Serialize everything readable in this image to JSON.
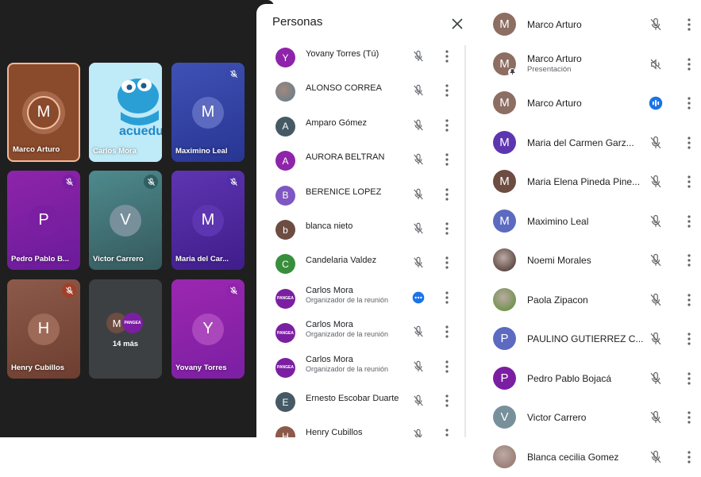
{
  "video_grid": {
    "tiles": [
      {
        "name": "Marco Arturo",
        "initial": "M",
        "muted": false
      },
      {
        "name": "Carlos Mora",
        "initial": "",
        "muted": false,
        "logo_text": "acuedu"
      },
      {
        "name": "Maximino Leal",
        "initial": "M",
        "muted": true
      },
      {
        "name": "Pedro Pablo B...",
        "initial": "P",
        "muted": true
      },
      {
        "name": "Victor Carrero",
        "initial": "V",
        "muted": true
      },
      {
        "name": "Maria del Car...",
        "initial": "M",
        "muted": true
      },
      {
        "name": "Henry Cubillos",
        "initial": "H",
        "muted": true
      },
      {
        "name": "14 más",
        "initial": "M",
        "muted": false,
        "badge_text": "PANGEA"
      },
      {
        "name": "Yovany Torres",
        "initial": "Y",
        "muted": true
      }
    ]
  },
  "panel": {
    "title": "Personas",
    "close_icon": "close-icon",
    "participants": [
      {
        "initial": "Y",
        "name": "Yovany Torres (Tú)",
        "subtitle": "",
        "color": "#8e24aa",
        "mic": "muted"
      },
      {
        "initial": "",
        "name": "ALONSO CORREA",
        "subtitle": "",
        "color": "#607d8b",
        "mic": "muted",
        "photo": true
      },
      {
        "initial": "A",
        "name": "Amparo Gómez",
        "subtitle": "",
        "color": "#455a64",
        "mic": "muted"
      },
      {
        "initial": "A",
        "name": "AURORA BELTRAN",
        "subtitle": "",
        "color": "#8e24aa",
        "mic": "muted"
      },
      {
        "initial": "B",
        "name": "BERENICE LOPEZ",
        "subtitle": "",
        "color": "#7e57c2",
        "mic": "muted"
      },
      {
        "initial": "b",
        "name": "blanca nieto",
        "subtitle": "",
        "color": "#6d4c41",
        "mic": "muted"
      },
      {
        "initial": "C",
        "name": "Candelaria Valdez",
        "subtitle": "",
        "color": "#388e3c",
        "mic": "muted"
      },
      {
        "initial": "PANGEA",
        "name": "Carlos Mora",
        "subtitle": "Organizador de la reunión",
        "color": "#7b1fa2",
        "mic": "active"
      },
      {
        "initial": "PANGEA",
        "name": "Carlos Mora",
        "subtitle": "Organizador de la reunión",
        "color": "#7b1fa2",
        "mic": "muted"
      },
      {
        "initial": "PANGEA",
        "name": "Carlos Mora",
        "subtitle": "Organizador de la reunión",
        "color": "#7b1fa2",
        "mic": "muted"
      },
      {
        "initial": "E",
        "name": "Ernesto Escobar Duarte",
        "subtitle": "",
        "color": "#455a64",
        "mic": "muted"
      },
      {
        "initial": "H",
        "name": "Henry Cubillos",
        "subtitle": "",
        "color": "#8d5a4a",
        "mic": "muted"
      }
    ]
  },
  "right_list": {
    "participants": [
      {
        "initial": "M",
        "name": "Marco Arturo",
        "subtitle": "",
        "color": "#8d6e63",
        "mic": "muted"
      },
      {
        "initial": "M",
        "name": "Marco Arturo",
        "subtitle": "Presentación",
        "color": "#8d6e63",
        "mic": "presenting"
      },
      {
        "initial": "M",
        "name": "Marco Arturo",
        "subtitle": "",
        "color": "#8d6e63",
        "mic": "speaking"
      },
      {
        "initial": "M",
        "name": "Maria del Carmen Garz...",
        "subtitle": "",
        "color": "#5e35b1",
        "mic": "muted"
      },
      {
        "initial": "M",
        "name": "Maria Elena Pineda Pine...",
        "subtitle": "",
        "color": "#6d4c41",
        "mic": "muted"
      },
      {
        "initial": "M",
        "name": "Maximino Leal",
        "subtitle": "",
        "color": "#5c6bc0",
        "mic": "muted"
      },
      {
        "initial": "",
        "name": "Noemi Morales",
        "subtitle": "",
        "color": "#3e2723",
        "mic": "muted",
        "photo": true
      },
      {
        "initial": "",
        "name": "Paola Zipacon",
        "subtitle": "",
        "color": "#558b2f",
        "mic": "muted",
        "photo": true
      },
      {
        "initial": "P",
        "name": "PAULINO GUTIERREZ C...",
        "subtitle": "",
        "color": "#5c6bc0",
        "mic": "muted"
      },
      {
        "initial": "P",
        "name": "Pedro Pablo Bojacá",
        "subtitle": "",
        "color": "#7b1fa2",
        "mic": "muted"
      },
      {
        "initial": "V",
        "name": "Victor Carrero",
        "subtitle": "",
        "color": "#78909c",
        "mic": "muted"
      },
      {
        "initial": "",
        "name": "Blanca cecilia Gomez",
        "subtitle": "",
        "color": "#8d6e63",
        "mic": "muted",
        "photo": true
      }
    ]
  }
}
